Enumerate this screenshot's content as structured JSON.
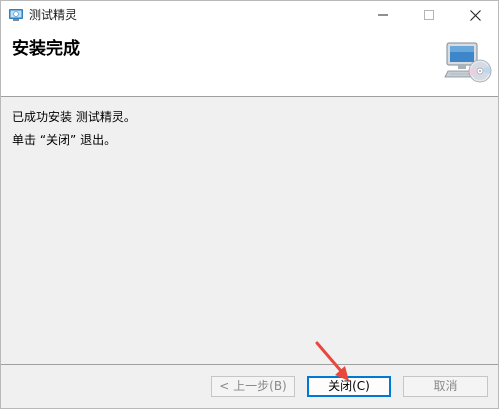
{
  "window": {
    "title": "测试精灵",
    "app_icon": "installer-app-icon",
    "controls": {
      "minimize_icon": "minimize-icon",
      "maximize_icon": "maximize-icon",
      "close_icon": "close-icon"
    }
  },
  "header": {
    "title": "安装完成",
    "icon": "computer-cd-icon"
  },
  "body": {
    "message_success": "已成功安装 测试精灵。",
    "message_instruction": "单击 “关闭” 退出。"
  },
  "buttons": {
    "back_label": "< 上一步(B)",
    "finish_label": "关闭(C)",
    "cancel_label": "取消"
  },
  "colors": {
    "accent": "#0078d4",
    "annotation_arrow": "#e8473d",
    "disabled_text": "#8a8a8a"
  }
}
